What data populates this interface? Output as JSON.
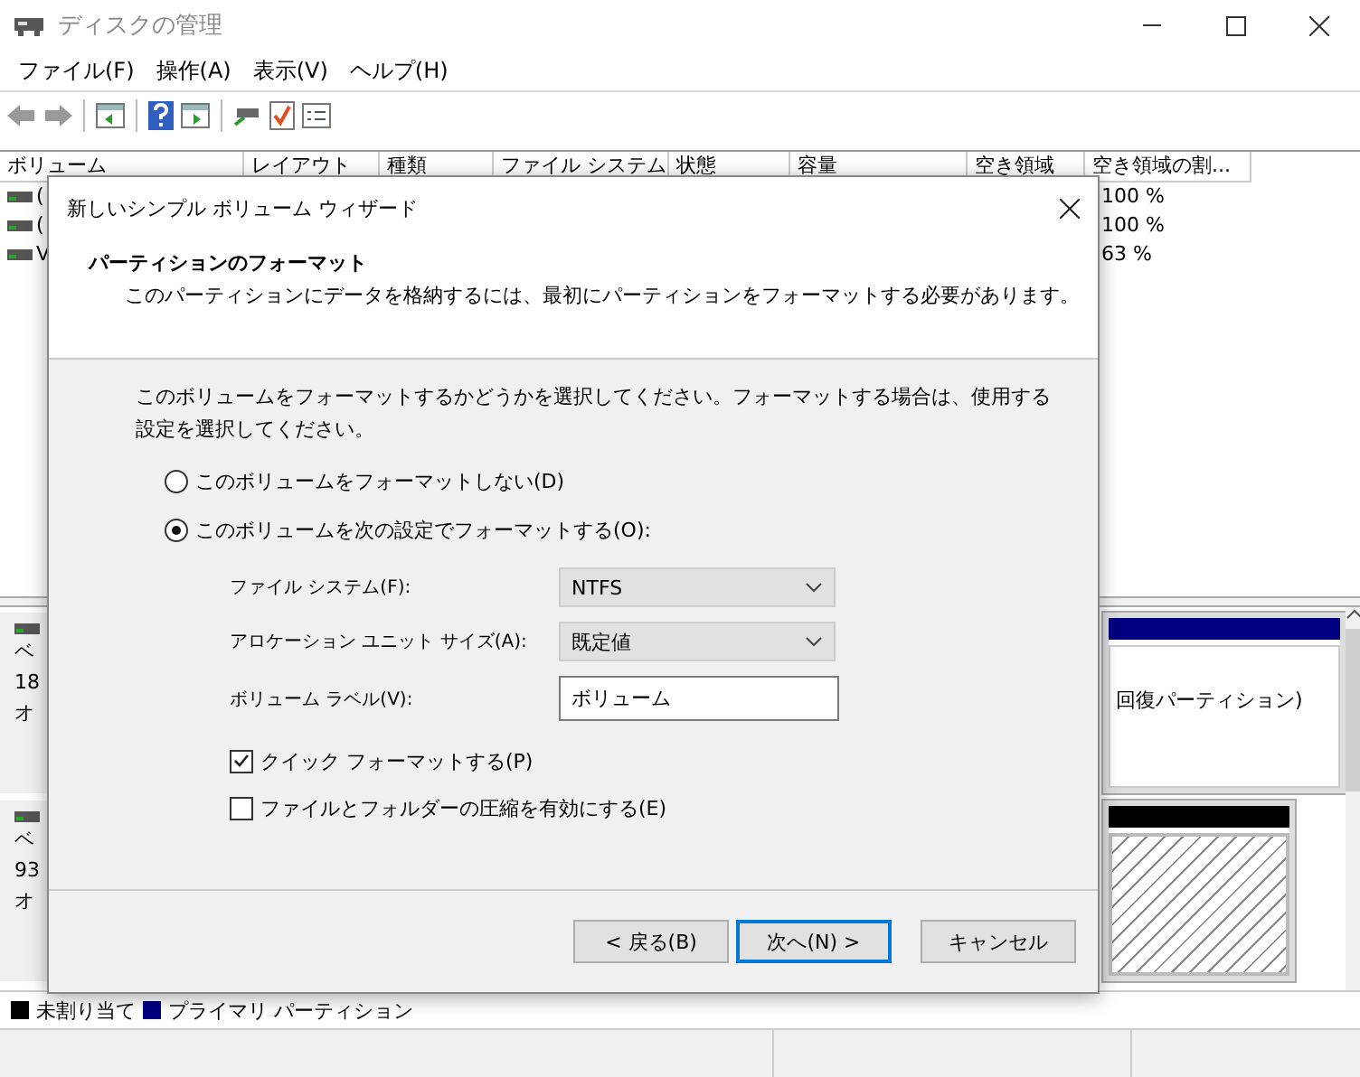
{
  "window": {
    "title": "ディスクの管理"
  },
  "menu": [
    "ファイル(F)",
    "操作(A)",
    "表示(V)",
    "ヘルプ(H)"
  ],
  "volume_table": {
    "columns": [
      "ボリューム",
      "レイアウト",
      "種類",
      "ファイル システム",
      "状態",
      "容量",
      "空き領域",
      "空き領域の割..."
    ],
    "rows": [
      {
        "volume": "(",
        "free_percent": "100 %"
      },
      {
        "volume": "(",
        "free_percent": "100 %"
      },
      {
        "volume": "V",
        "free_percent": "63 %"
      }
    ]
  },
  "disks": [
    {
      "label_lines": [
        "ベ",
        "18",
        "オ"
      ],
      "partition": {
        "kind": "primary",
        "color": "#000080",
        "lines": [
          "回復パーティション)"
        ]
      }
    },
    {
      "label_lines": [
        "ベ",
        "93",
        "オ"
      ],
      "partition": {
        "kind": "unallocated",
        "color": "#000000"
      }
    }
  ],
  "legend": [
    {
      "label": "未割り当て",
      "color": "#000000"
    },
    {
      "label": "プライマリ パーティション",
      "color": "#000080"
    }
  ],
  "dialog": {
    "title": "新しいシンプル ボリューム ウィザード",
    "heading": "パーティションのフォーマット",
    "subheading": "このパーティションにデータを格納するには、最初にパーティションをフォーマットする必要があります。",
    "prompt": "このボリュームをフォーマットするかどうかを選択してください。フォーマットする場合は、使用する設定を選択してください。",
    "options": [
      {
        "label": "このボリュームをフォーマットしない(D)",
        "selected": false
      },
      {
        "label": "このボリュームを次の設定でフォーマットする(O):",
        "selected": true
      }
    ],
    "settings": [
      {
        "kind": "select",
        "label": "ファイル システム(F):",
        "value": "NTFS"
      },
      {
        "kind": "select",
        "label": "アロケーション ユニット サイズ(A):",
        "value": "既定値"
      },
      {
        "kind": "text",
        "label": "ボリューム ラベル(V):",
        "value": "ボリューム"
      }
    ],
    "checkboxes": [
      {
        "label": "クイック フォーマットする(P)",
        "checked": true
      },
      {
        "label": "ファイルとフォルダーの圧縮を有効にする(E)",
        "checked": false
      }
    ],
    "buttons": [
      {
        "label": "< 戻る(B)",
        "default": false
      },
      {
        "label": "次へ(N) >",
        "default": true
      },
      {
        "label": "キャンセル",
        "default": false
      }
    ]
  }
}
